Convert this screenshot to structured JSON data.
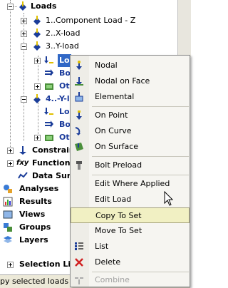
{
  "tree": {
    "loads": "Loads",
    "load1": "1..Component Load - Z",
    "load2": "2..X-load",
    "load3": "3..Y-load",
    "load3_child1": "Lo",
    "load3_child2": "Bo",
    "load3_child3": "Ot",
    "load4": "4..-Y-l",
    "load4_child1": "Lo",
    "load4_child2": "Bo",
    "load4_child3": "Ot",
    "constraints": "Constrain",
    "functions": "Functions",
    "data_surfaces": "Data Surf",
    "analyses": "Analyses",
    "results": "Results",
    "views": "Views",
    "groups": "Groups",
    "layers": "Layers",
    "selection_list": "Selection Lis"
  },
  "context_menu": {
    "items": [
      {
        "label": "Nodal"
      },
      {
        "label": "Nodal on Face"
      },
      {
        "label": "Elemental"
      },
      {
        "label": "On Point"
      },
      {
        "label": "On Curve"
      },
      {
        "label": "On Surface"
      },
      {
        "label": "Bolt Preload"
      },
      {
        "label": "Edit Where Applied"
      },
      {
        "label": "Edit Load"
      },
      {
        "label": "Copy To Set"
      },
      {
        "label": "Move To Set"
      },
      {
        "label": "List"
      },
      {
        "label": "Delete"
      },
      {
        "label": "Combine"
      }
    ]
  },
  "status_bar": {
    "text": "py selected loads t"
  },
  "colors": {
    "accent": "#3168c6",
    "highlight": "#f1f0c3",
    "tree_text_blue": "#1c3c9c"
  }
}
